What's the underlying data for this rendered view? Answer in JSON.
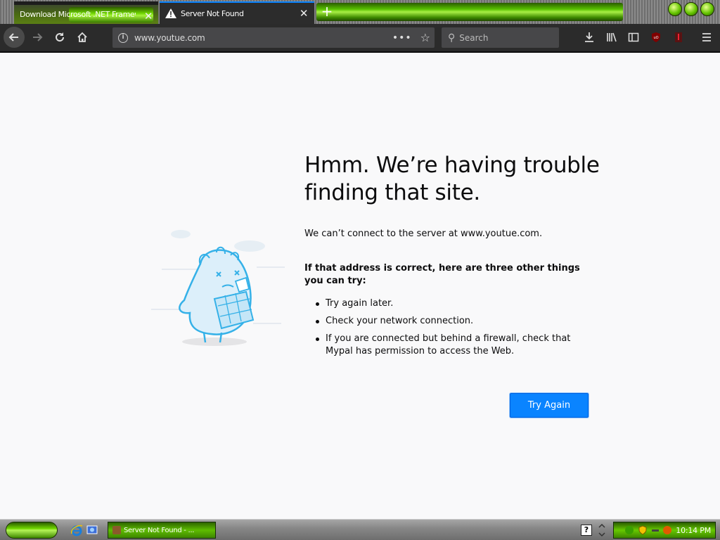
{
  "tabs": [
    {
      "title": "Download Microsoft .NET Framew",
      "close": "✕"
    },
    {
      "title": "Server Not Found",
      "close": "✕"
    }
  ],
  "newtab": "+",
  "nav": {
    "url": "www.youtue.com",
    "search_placeholder": "Search",
    "page_actions": "•••"
  },
  "error": {
    "title": "Hmm. We’re having trouble finding that site.",
    "description": "We can’t connect to the server at www.youtue.com.",
    "subheading": "If that address is correct, here are three other things you can try:",
    "tips": [
      "Try again later.",
      "Check your network connection.",
      "If you are connected but behind a firewall, check that Mypal has permission to access the Web."
    ],
    "button": "Try Again"
  },
  "taskbar": {
    "task_label": "Server Not Found - ...",
    "help": "?",
    "clock": "10:14 PM"
  },
  "colors": {
    "accent": "#0a84ff",
    "page_bg": "#f9f9fa",
    "toolbar_bg": "#2b2b2b",
    "skin_green": "#67c900"
  }
}
